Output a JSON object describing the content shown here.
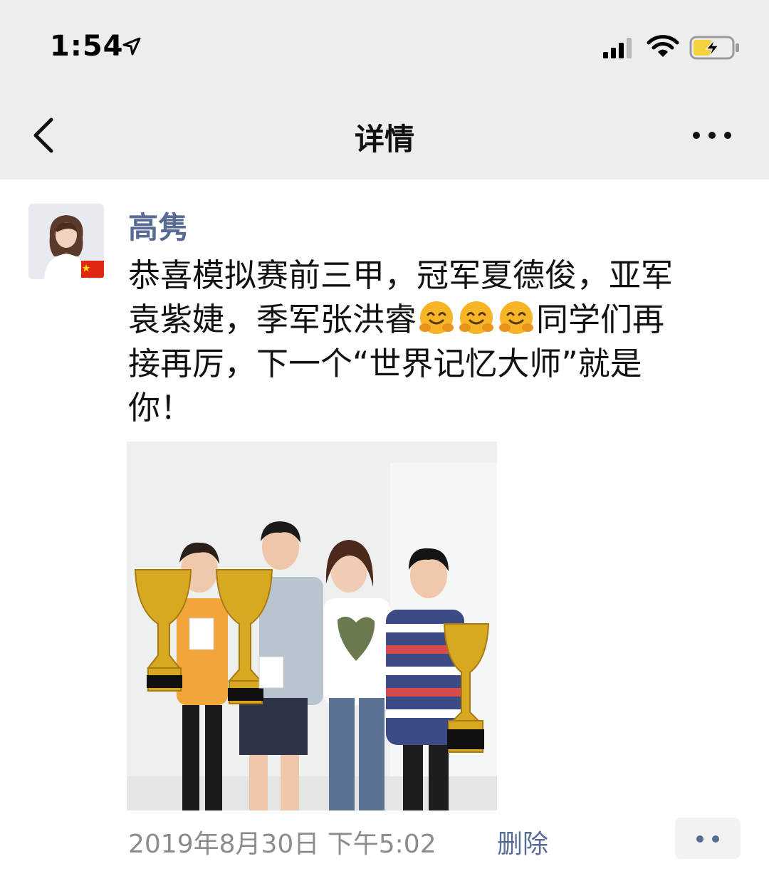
{
  "status_bar": {
    "time": "1:54",
    "icons": [
      "location-arrow-icon",
      "signal-icon",
      "wifi-icon",
      "battery-charging-icon"
    ]
  },
  "nav": {
    "title": "详情",
    "back_icon": "chevron-left-icon",
    "more_icon": "more-dots-icon"
  },
  "post": {
    "author": "高隽",
    "text_lines": [
      "恭喜模拟赛前三甲，冠军夏德俊，亚军",
      "袁紫婕，季军张洪睿",
      "同学们再",
      "接再厉，下一个“世界记忆大师”就是",
      "你！"
    ],
    "emoji_count": 3,
    "emoji_icon": "hugging-face-icon",
    "photo": "group-photo-with-trophies",
    "timestamp": "2019年8月30日 下午5:02",
    "delete_label": "删除",
    "comment_icon": "comment-dots-icon"
  },
  "colors": {
    "header_bg": "#ededed",
    "link_blue": "#576b95",
    "timestamp_grey": "#8c8c8c"
  }
}
